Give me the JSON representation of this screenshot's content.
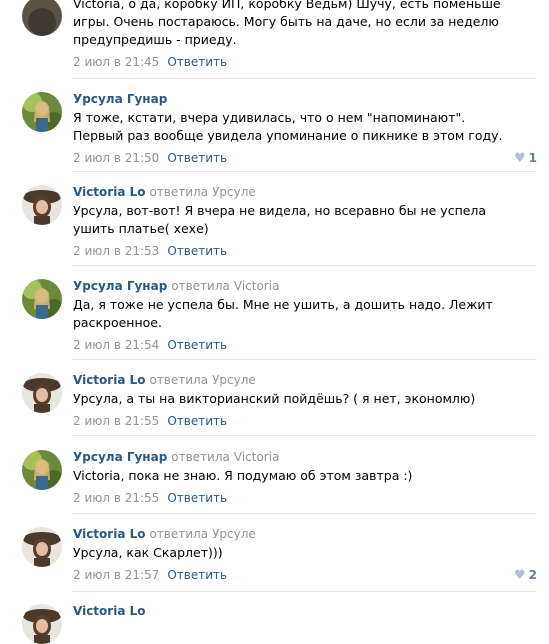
{
  "comments": [
    {
      "author": "",
      "replied_label": "",
      "reply_to": "",
      "text": "Victoria, о да, коробку ИП, коробку Ведьм) Шучу, есть поменьше игры. Очень постараюсь. Могу быть на даче, но если за неделю предупредишь - приеду.",
      "date": "2 июл в 21:45",
      "reply_label": "Ответить",
      "likes": ""
    },
    {
      "author": "Урсула Гунар",
      "replied_label": "",
      "reply_to": "",
      "text": "Я тоже, кстати, вчера удивилась, что о нем \"напоминают\". Первый раз вообще увидела упоминание о пикнике в этом году.",
      "date": "2 июл в 21:50",
      "reply_label": "Ответить",
      "likes": "1"
    },
    {
      "author": "Victoria Lo",
      "replied_label": "ответила",
      "reply_to": "Урсуле",
      "text": "Урсула, вот-вот! Я вчера не видела, но всеравно бы не успела ушить платье( хехе)",
      "date": "2 июл в 21:53",
      "reply_label": "Ответить",
      "likes": ""
    },
    {
      "author": "Урсула Гунар",
      "replied_label": "ответила",
      "reply_to": "Victoria",
      "text": "Да, я тоже не успела бы. Мне не ушить, а дошить надо. Лежит раскроенное.",
      "date": "2 июл в 21:54",
      "reply_label": "Ответить",
      "likes": ""
    },
    {
      "author": "Victoria Lo",
      "replied_label": "ответила",
      "reply_to": "Урсуле",
      "text": "Урсула, а ты на викторианский пойдёшь? ( я нет, экономлю)",
      "date": "2 июл в 21:55",
      "reply_label": "Ответить",
      "likes": ""
    },
    {
      "author": "Урсула Гунар",
      "replied_label": "ответила",
      "reply_to": "Victoria",
      "text": "Victoria, пока не знаю. Я подумаю об этом завтра :)",
      "date": "2 июл в 21:55",
      "reply_label": "Ответить",
      "likes": ""
    },
    {
      "author": "Victoria Lo",
      "replied_label": "ответила",
      "reply_to": "Урсуле",
      "text": "Урсула, как Скарлет)))",
      "date": "2 июл в 21:57",
      "reply_label": "Ответить",
      "likes": "2"
    },
    {
      "author": "Victoria Lo",
      "replied_label": "",
      "reply_to": "",
      "text": "",
      "date": "",
      "reply_label": "",
      "likes": ""
    }
  ],
  "colors": {
    "link": "#2a5885",
    "meta": "#939393",
    "divider": "#e7e8ec",
    "like_heart": "#aebfd3"
  },
  "icons": {
    "like": "heart-icon"
  }
}
